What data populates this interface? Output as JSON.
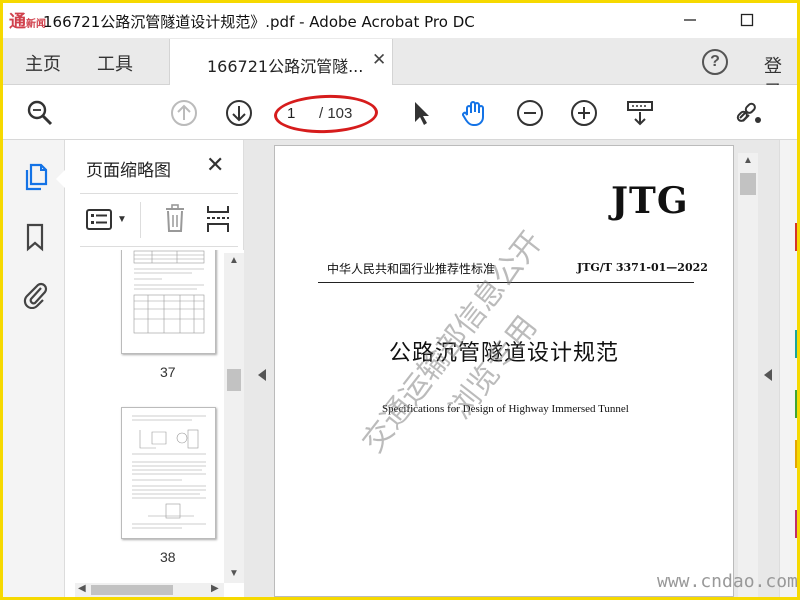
{
  "window": {
    "title": "166721公路沉管隧道设计规范》.pdf - Adobe Acrobat Pro DC",
    "logo_text": "通",
    "logo_small": "新闻"
  },
  "tabs": {
    "home_label": "主页",
    "tools_label": "工具",
    "document_tab_label": "166721公路沉管隧...",
    "login_label": "登录"
  },
  "toolbar": {
    "current_page": "1",
    "total_pages": "/ 103",
    "highlight_color": "#d61c1c",
    "icons": [
      "search-icon",
      "prev-page-icon",
      "next-page-icon",
      "select-cursor-icon",
      "hand-tool-icon",
      "zoom-out-icon",
      "zoom-in-icon",
      "scroll-mode-icon",
      "share-link-icon"
    ]
  },
  "sidebar": {
    "panel_title": "页面缩略图",
    "icons": [
      "page-thumbnails-icon",
      "bookmark-icon",
      "attachment-icon"
    ],
    "thumbnails": [
      {
        "page_number": "37"
      },
      {
        "page_number": "38"
      }
    ]
  },
  "document": {
    "logo": "JTG",
    "standard_label": "中华人民共和国行业推荐性标准",
    "standard_code": "JTG/T  3371-01—2022",
    "title_cn": "公路沉管隧道设计规范",
    "title_en": "Specifications for Design of Highway Immersed Tunnel",
    "watermark_lines": [
      "交通运输部信息公开",
      "浏览专用"
    ],
    "site_watermark": "www.cndao.com"
  },
  "colors": {
    "frame": "#f6d900",
    "accent": "#1473e6"
  }
}
